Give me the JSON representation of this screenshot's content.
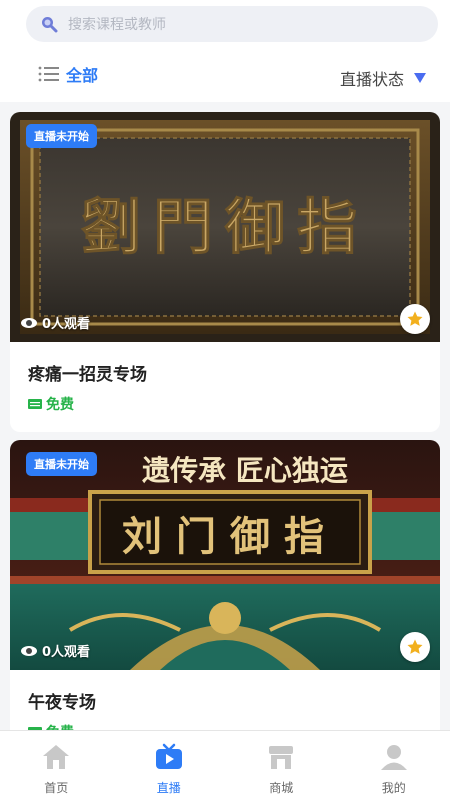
{
  "search": {
    "placeholder": "搜索课程或教师"
  },
  "filter": {
    "all_label": "全部",
    "status_label": "直播状态"
  },
  "cards": [
    {
      "badge": "直播未开始",
      "viewers": "0人观看",
      "title": "疼痛一招灵专场",
      "price": "免费",
      "image_text": "劉門御指"
    },
    {
      "badge": "直播未开始",
      "viewers": "0人观看",
      "title": "午夜专场",
      "price": "免费",
      "image_banner": "遗传承  匠心独运",
      "image_text": "刘门御指"
    }
  ],
  "tabs": [
    {
      "label": "首页",
      "icon": "home-icon"
    },
    {
      "label": "直播",
      "icon": "tv-icon"
    },
    {
      "label": "商城",
      "icon": "store-icon"
    },
    {
      "label": "我的",
      "icon": "user-icon"
    }
  ],
  "colors": {
    "accent": "#2e7cf6",
    "free": "#27b34a"
  }
}
